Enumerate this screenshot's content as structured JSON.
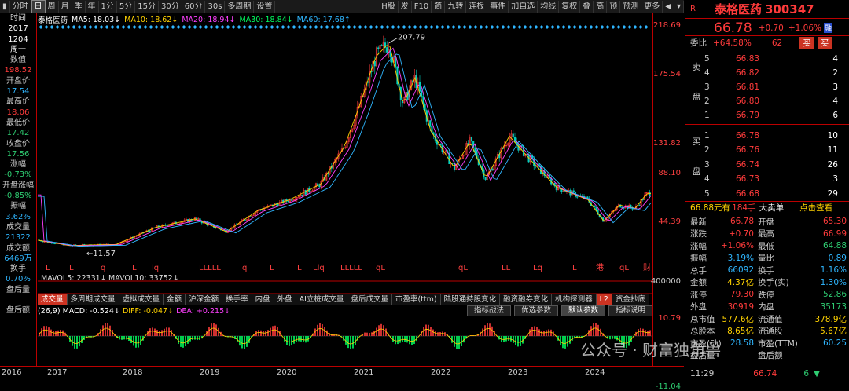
{
  "toolbar": {
    "left": [
      "分时",
      "日",
      "周",
      "月",
      "季",
      "年",
      "1分",
      "5分",
      "15分",
      "30分",
      "60分",
      "30s",
      "多周期",
      "设置"
    ],
    "active": "日",
    "right": [
      "H股",
      "发",
      "F10",
      "简",
      "九转",
      "连板",
      "事件",
      "加自选",
      "均线",
      "复权",
      "叠",
      "高",
      "预",
      "预测",
      "更多"
    ]
  },
  "left_panel": [
    {
      "l": "时间",
      "v": "2017",
      "c": "white"
    },
    {
      "l": "",
      "v": "1204",
      "c": "white"
    },
    {
      "l": "",
      "v": "周一",
      "c": "white"
    },
    {
      "l": "数值",
      "v": "198.52",
      "c": "red"
    },
    {
      "l": "开盘价",
      "v": "17.54",
      "c": "cyan"
    },
    {
      "l": "最高价",
      "v": "18.06",
      "c": "red"
    },
    {
      "l": "最低价",
      "v": "17.42",
      "c": "green"
    },
    {
      "l": "收盘价",
      "v": "17.56",
      "c": "green"
    },
    {
      "l": "涨幅",
      "v": "-0.73%",
      "c": "green"
    },
    {
      "l": "开盘涨幅",
      "v": "-0.85%",
      "c": "green"
    },
    {
      "l": "振幅",
      "v": "3.62%",
      "c": "cyan"
    },
    {
      "l": "成交量",
      "v": "21322",
      "c": "cyan"
    },
    {
      "l": "成交额",
      "v": "6469万",
      "c": "cyan"
    },
    {
      "l": "换手",
      "v": "0.70%",
      "c": "cyan"
    },
    {
      "l": "盘后量",
      "v": "",
      "c": "cyan"
    },
    {
      "l": "盘后额",
      "v": "",
      "c": "cyan"
    }
  ],
  "legend": {
    "name": "泰格医药",
    "ma5": "MA5: 18.03↓",
    "ma10": "MA10: 18.62↓",
    "ma20": "MA20: 18.94↓",
    "ma30": "MA30: 18.84↓",
    "ma60": "MA60: 17.68↑"
  },
  "price_axis": [
    "218.69",
    "175.54",
    "131.82",
    "88.10",
    "44.39"
  ],
  "high_marker": "207.79",
  "low_marker": "11.57",
  "vol_legend": {
    "a": "MAVOL5: 22331↓",
    "b": "MAVOL10: 33752↓"
  },
  "vol_axis": "400000",
  "tabs": [
    "成交量",
    "多周期成交量",
    "虚拟成交量",
    "金额",
    "沪深金额",
    "换手率",
    "内盘",
    "外盘",
    "AI立桩成交量",
    "盘后成交量",
    "市盈率(ttm)",
    "陆股通持股变化",
    "融资融券变化",
    "机构探测器",
    "L2",
    "资金抄底"
  ],
  "macd": {
    "params": "(26,9)",
    "macd": "MACD: -0.524↓",
    "diff": "DIFF: -0.047↓",
    "dea": "DEA: +0.215↓",
    "btns": [
      "指标战法",
      "优选参数",
      "默认参数",
      "指标说明"
    ],
    "axis_top": "10.79",
    "axis_bot": "-11.04"
  },
  "years": [
    "2016",
    "2017",
    "2018",
    "2019",
    "2020",
    "2021",
    "2022",
    "2023",
    "2024"
  ],
  "quote": {
    "name": "泰格医药",
    "code": "300347",
    "price": "66.78",
    "chg": "+0.70",
    "pct": "+1.06%",
    "tag": "融",
    "weibi_l": "委比",
    "weibi": "+64.58%",
    "weicha": "62",
    "sell_btn": "买",
    "buy_btn": "买",
    "asks": [
      [
        "5",
        "66.83",
        "4"
      ],
      [
        "4",
        "66.82",
        "2"
      ],
      [
        "3",
        "66.81",
        "3"
      ],
      [
        "2",
        "66.80",
        "4"
      ],
      [
        "1",
        "66.79",
        "6"
      ]
    ],
    "bids": [
      [
        "1",
        "66.78",
        "10"
      ],
      [
        "2",
        "66.76",
        "11"
      ],
      [
        "3",
        "66.74",
        "26"
      ],
      [
        "4",
        "66.73",
        "3"
      ],
      [
        "5",
        "66.68",
        "29"
      ]
    ],
    "sell_label": "卖盘",
    "buy_label": "买盘",
    "info_a": "66.88元有",
    "info_b": "184手",
    "info_c": "大卖单",
    "info_d": "点击查看",
    "stats": [
      [
        "最新",
        "66.78",
        "red",
        "开盘",
        "65.30",
        "red"
      ],
      [
        "涨跌",
        "+0.70",
        "red",
        "最高",
        "66.99",
        "red"
      ],
      [
        "涨幅",
        "+1.06%",
        "red",
        "最低",
        "64.88",
        "green"
      ],
      [
        "振幅",
        "3.19%",
        "cyan",
        "量比",
        "0.89",
        "cyan"
      ],
      [
        "总手",
        "66092",
        "cyan",
        "换手",
        "1.16%",
        "cyan"
      ],
      [
        "金额",
        "4.37亿",
        "yellow",
        "换手(实)",
        "1.30%",
        "cyan"
      ],
      [
        "涨停",
        "79.30",
        "red",
        "跌停",
        "52.86",
        "green"
      ],
      [
        "外盘",
        "30919",
        "red",
        "内盘",
        "35173",
        "green"
      ],
      [
        "总市值",
        "577.6亿",
        "yellow",
        "流通值",
        "378.9亿",
        "yellow"
      ],
      [
        "总股本",
        "8.65亿",
        "yellow",
        "流通股",
        "5.67亿",
        "yellow"
      ],
      [
        "市盈(动)",
        "28.58",
        "cyan",
        "市盈(TTM)",
        "60.25",
        "cyan"
      ],
      [
        "盘后量",
        "",
        "cyan",
        "盘后额",
        "",
        "cyan"
      ]
    ],
    "tick_time": "11:29",
    "tick_price": "66.74",
    "tick_vol": "6"
  },
  "watermark": "公众号 · 财富独角兽",
  "colors": {
    "up": "#ff3b3b",
    "down": "#00d0c0",
    "ma5": "#ffffff",
    "ma10": "#ffd200",
    "ma20": "#ff40ff",
    "ma30": "#00ff60",
    "ma60": "#2fb6ff"
  }
}
